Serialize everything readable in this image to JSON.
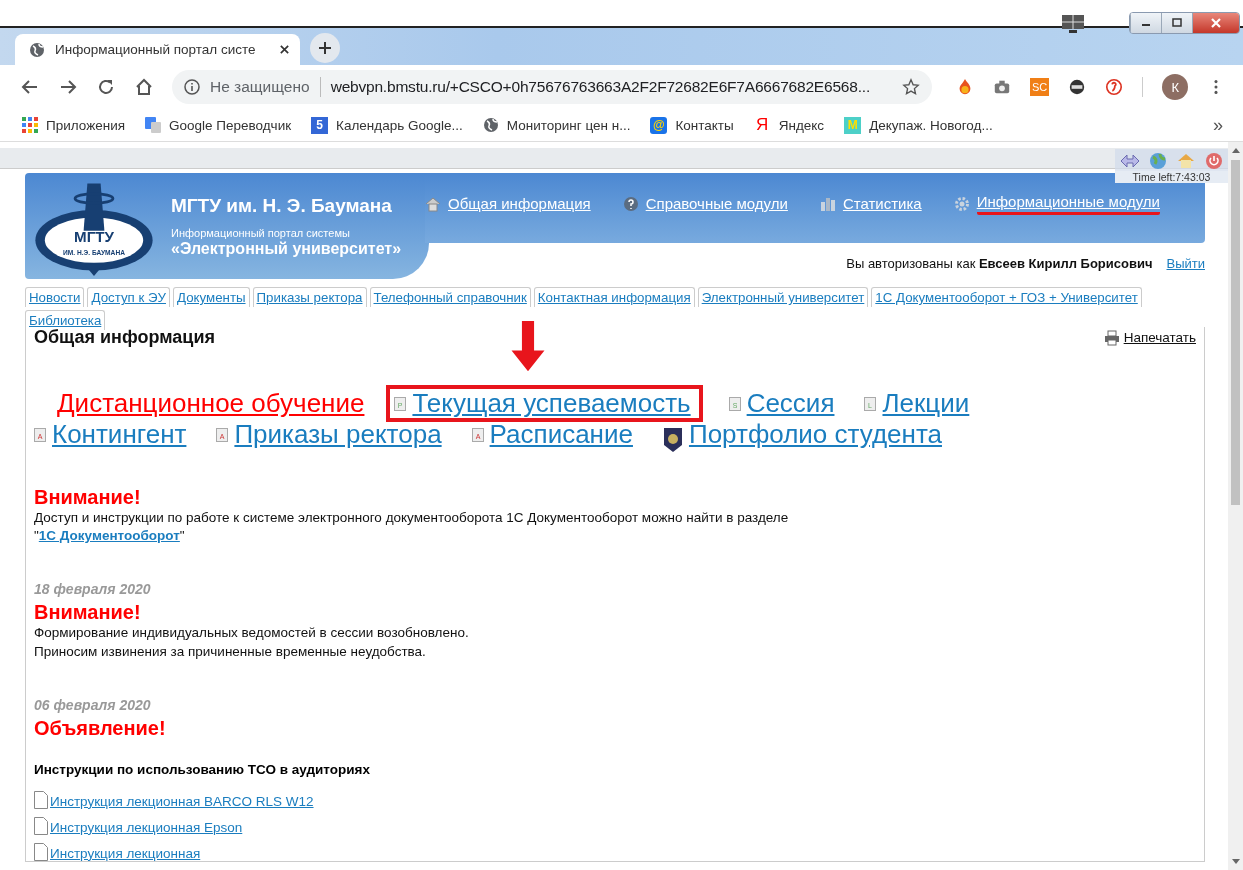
{
  "browser": {
    "tab_title": "Информационный портал систе",
    "security": "Не защищено",
    "url": "webvpn.bmstu.ru/+CSCO+0h75676763663A2F2F72682E6F7A6667682E6568...",
    "extension_badge": "SC",
    "profile_initial": "К",
    "bookmarks_more": "»",
    "bookmarks": [
      {
        "label": "Приложения",
        "kind": "apps"
      },
      {
        "label": "Google Переводчик",
        "kind": "translate"
      },
      {
        "label": "Календарь Google...",
        "kind": "calendar",
        "glyph": "5"
      },
      {
        "label": "Мониторинг цен н...",
        "kind": "globe"
      },
      {
        "label": "Контакты",
        "kind": "mail",
        "glyph": "@"
      },
      {
        "label": "Яндекс",
        "kind": "yandex",
        "glyph": "Я"
      },
      {
        "label": "Декупаж. Новогод...",
        "kind": "letter",
        "glyph": "M"
      }
    ]
  },
  "vpn_toolbar": {
    "time_left": "Time left:7:43:03"
  },
  "header": {
    "title": "МГТУ им. Н. Э. Баумана",
    "subtitle": "Информационный портал системы",
    "system_name": "«Электронный университет»",
    "logo_top": "МГТУ",
    "logo_bottom": "ИМ. Н.Э. БАУМАНА",
    "nav": [
      {
        "label": "Общая информация",
        "marked": false
      },
      {
        "label": "Справочные модули",
        "marked": false
      },
      {
        "label": "Статистика",
        "marked": false
      },
      {
        "label": "Информационные модули",
        "marked": true
      }
    ],
    "auth_prefix": "Вы авторизованы как",
    "user_name": "Евсеев Кирилл Борисович",
    "logout": "Выйти"
  },
  "tabs": [
    "Новости",
    "Доступ к ЭУ",
    "Документы",
    "Приказы ректора",
    "Телефонный справочник",
    "Контактная информация",
    "Электронный университет",
    "1С Документооборот + ГОЗ + Университет",
    "Библиотека"
  ],
  "content": {
    "title": "Общая информация",
    "print": "Напечатать",
    "modules": [
      {
        "label": "Дистанционное обучение",
        "kind": "featured",
        "highlighted": false
      },
      {
        "label": "Текущая успеваемость",
        "kind": "doc",
        "glyph": "P",
        "highlighted": true
      },
      {
        "label": "Сессия",
        "kind": "doc",
        "glyph": "S",
        "highlighted": false
      },
      {
        "label": "Лекции",
        "kind": "doc",
        "glyph": "L",
        "highlighted": false
      },
      {
        "label": "Контингент",
        "kind": "doc",
        "glyph": "A",
        "highlighted": false
      },
      {
        "label": "Приказы ректора",
        "kind": "doc",
        "glyph": "A",
        "highlighted": false
      },
      {
        "label": "Расписание",
        "kind": "doc",
        "glyph": "A",
        "highlighted": false
      },
      {
        "label": "Портфолио студента",
        "kind": "crest",
        "highlighted": false
      }
    ],
    "news": [
      {
        "heading": "Внимание!",
        "lines": [
          "Доступ и инструкции по работе к системе электронного документооборота 1С Документооборот можно найти в разделе"
        ],
        "link": "1С Документооборот",
        "quote": "\""
      },
      {
        "date": "18 февраля 2020",
        "heading": "Внимание!",
        "lines": [
          "Формирование индивидуальных ведомостей в сессии возобновлено.",
          "Приносим извинения за причиненные временные неудобства."
        ]
      },
      {
        "date": "06 февраля 2020",
        "heading": "Объявление!",
        "subheading": "Инструкции по использованию ТСО в аудиториях",
        "files": [
          "Инструкция лекционная BARCO RLS W12",
          "Инструкция лекционная Epson",
          "Инструкция лекционная"
        ]
      }
    ]
  }
}
